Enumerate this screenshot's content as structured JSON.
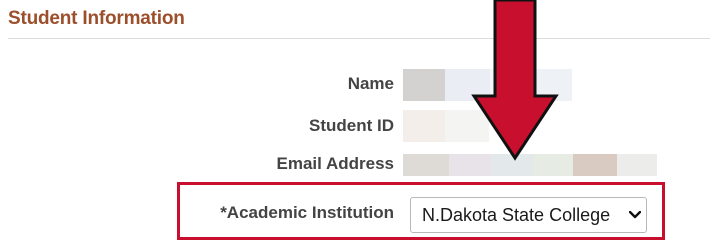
{
  "section": {
    "title": "Student Information"
  },
  "fields": {
    "name_label": "Name",
    "student_id_label": "Student ID",
    "email_label": "Email Address",
    "institution_label": "*Academic Institution",
    "institution_value": "N.Dakota State College"
  },
  "colors": {
    "section_title": "#9c4f2b",
    "highlight": "#c8102e",
    "label_text": "#444444"
  },
  "icons": {
    "select": "chevron-down-icon",
    "annotation": "down-arrow-icon"
  }
}
